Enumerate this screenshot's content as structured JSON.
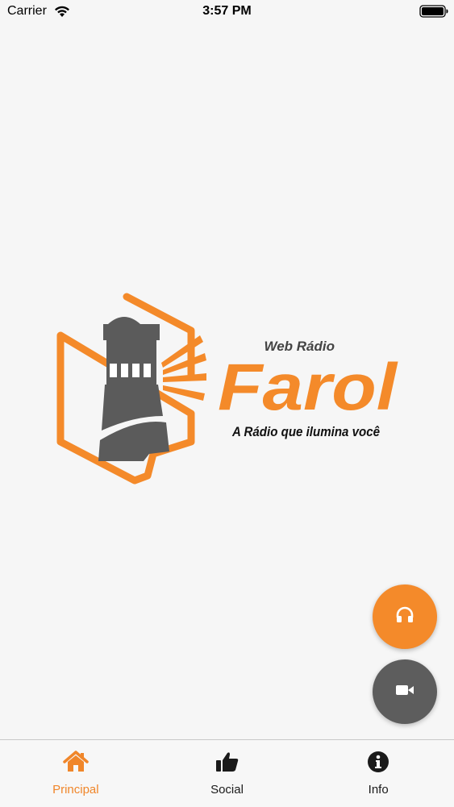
{
  "status_bar": {
    "carrier": "Carrier",
    "time": "3:57 PM",
    "wifi_icon": "wifi-icon",
    "battery_icon": "battery-icon"
  },
  "logo": {
    "subtitle": "Web Rádio",
    "title": "Farol",
    "tagline": "A Rádio que ilumina você",
    "colors": {
      "orange": "#f48a2a",
      "gray": "#5b5b5b"
    }
  },
  "fabs": {
    "audio": {
      "icon": "headphones-icon",
      "color": "#f48a2a"
    },
    "video": {
      "icon": "video-camera-icon",
      "color": "#5d5d5d"
    }
  },
  "tab_bar": {
    "tabs": [
      {
        "label": "Principal",
        "icon": "home-icon",
        "active": true
      },
      {
        "label": "Social",
        "icon": "thumbs-up-icon",
        "active": false
      },
      {
        "label": "Info",
        "icon": "info-icon",
        "active": false
      }
    ],
    "active_color": "#f0862a"
  }
}
